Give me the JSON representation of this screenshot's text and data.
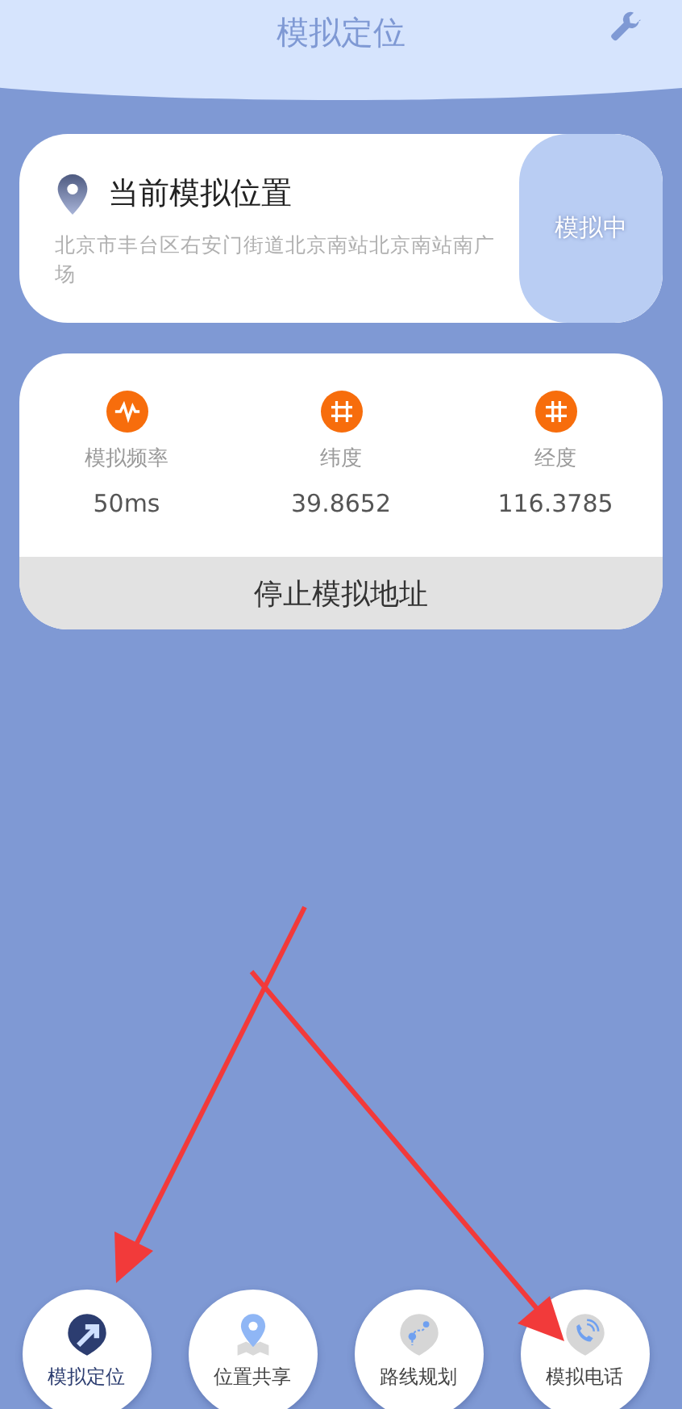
{
  "header": {
    "title": "模拟定位"
  },
  "location_card": {
    "title": "当前模拟位置",
    "address": "北京市丰台区右安门街道北京南站北京南站南广场",
    "status_button": "模拟中"
  },
  "stats": [
    {
      "kind": "wave",
      "label": "模拟频率",
      "value": "50ms"
    },
    {
      "kind": "grid",
      "label": "纬度",
      "value": "39.8652"
    },
    {
      "kind": "grid-vertical",
      "label": "经度",
      "value": "116.3785"
    }
  ],
  "stop_button": "停止模拟地址",
  "nav": [
    {
      "kind": "navigate",
      "label": "模拟定位",
      "selected": true
    },
    {
      "kind": "share",
      "label": "位置共享",
      "selected": false
    },
    {
      "kind": "route",
      "label": "路线规划",
      "selected": false
    },
    {
      "kind": "phone",
      "label": "模拟电话",
      "selected": false
    }
  ]
}
